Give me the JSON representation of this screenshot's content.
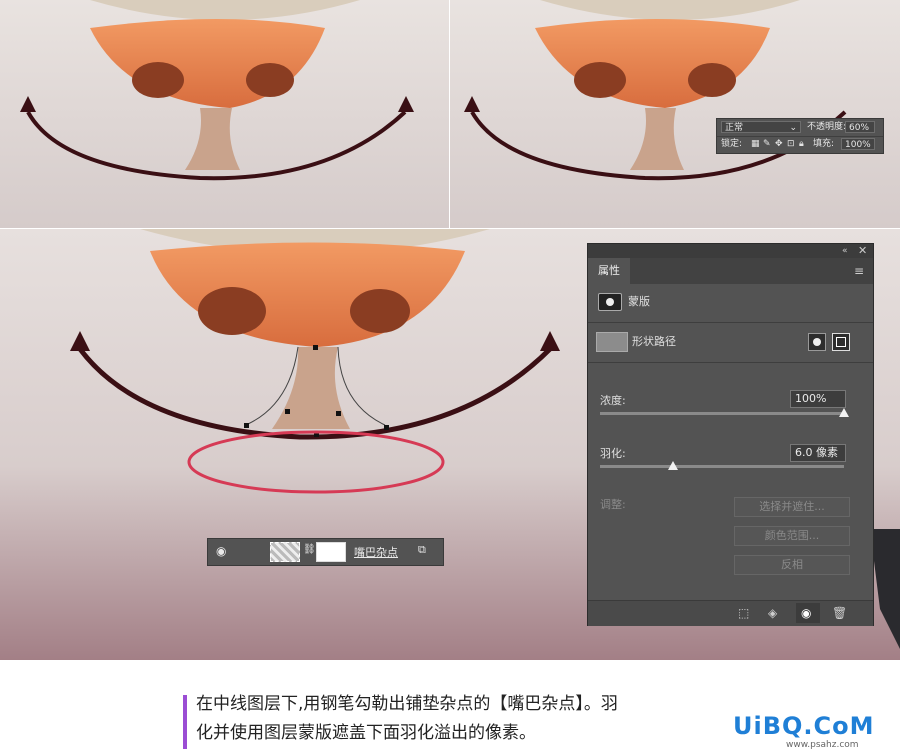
{
  "layer_options": {
    "blend_mode": "正常",
    "opacity_label": "不透明度:",
    "opacity_value": "60%",
    "lock_label": "锁定:",
    "fill_label": "填充:",
    "fill_value": "100%"
  },
  "properties": {
    "tab_label": "属性",
    "mask_label": "蒙版",
    "shape_path_label": "形状路径",
    "density_label": "浓度:",
    "density_value": "100%",
    "density_level": 1.0,
    "feather_label": "羽化:",
    "feather_value": "6.0 像素",
    "feather_level": 0.3,
    "adjust_label": "调整:",
    "select_and_mask_label": "选择并遮住...",
    "color_range_label": "颜色范围...",
    "invert_label": "反相"
  },
  "layer": {
    "name": "嘴巴杂点"
  },
  "caption": {
    "line1": "在中线图层下,用钢笔勾勒出铺垫杂点的【嘴巴杂点】。羽",
    "line2": "化并使用图层蒙版遮盖下面羽化溢出的像素。"
  },
  "watermark": {
    "logo": "UiBQ.CoM",
    "site": "www.psahz.com"
  },
  "colors": {
    "nose": "#e8834f",
    "mouth": "#3a0f14",
    "ellipse": "#d63a55",
    "panel": "#535353",
    "caption_bar": "#9b4dd4",
    "logo": "#1f7fd6"
  }
}
